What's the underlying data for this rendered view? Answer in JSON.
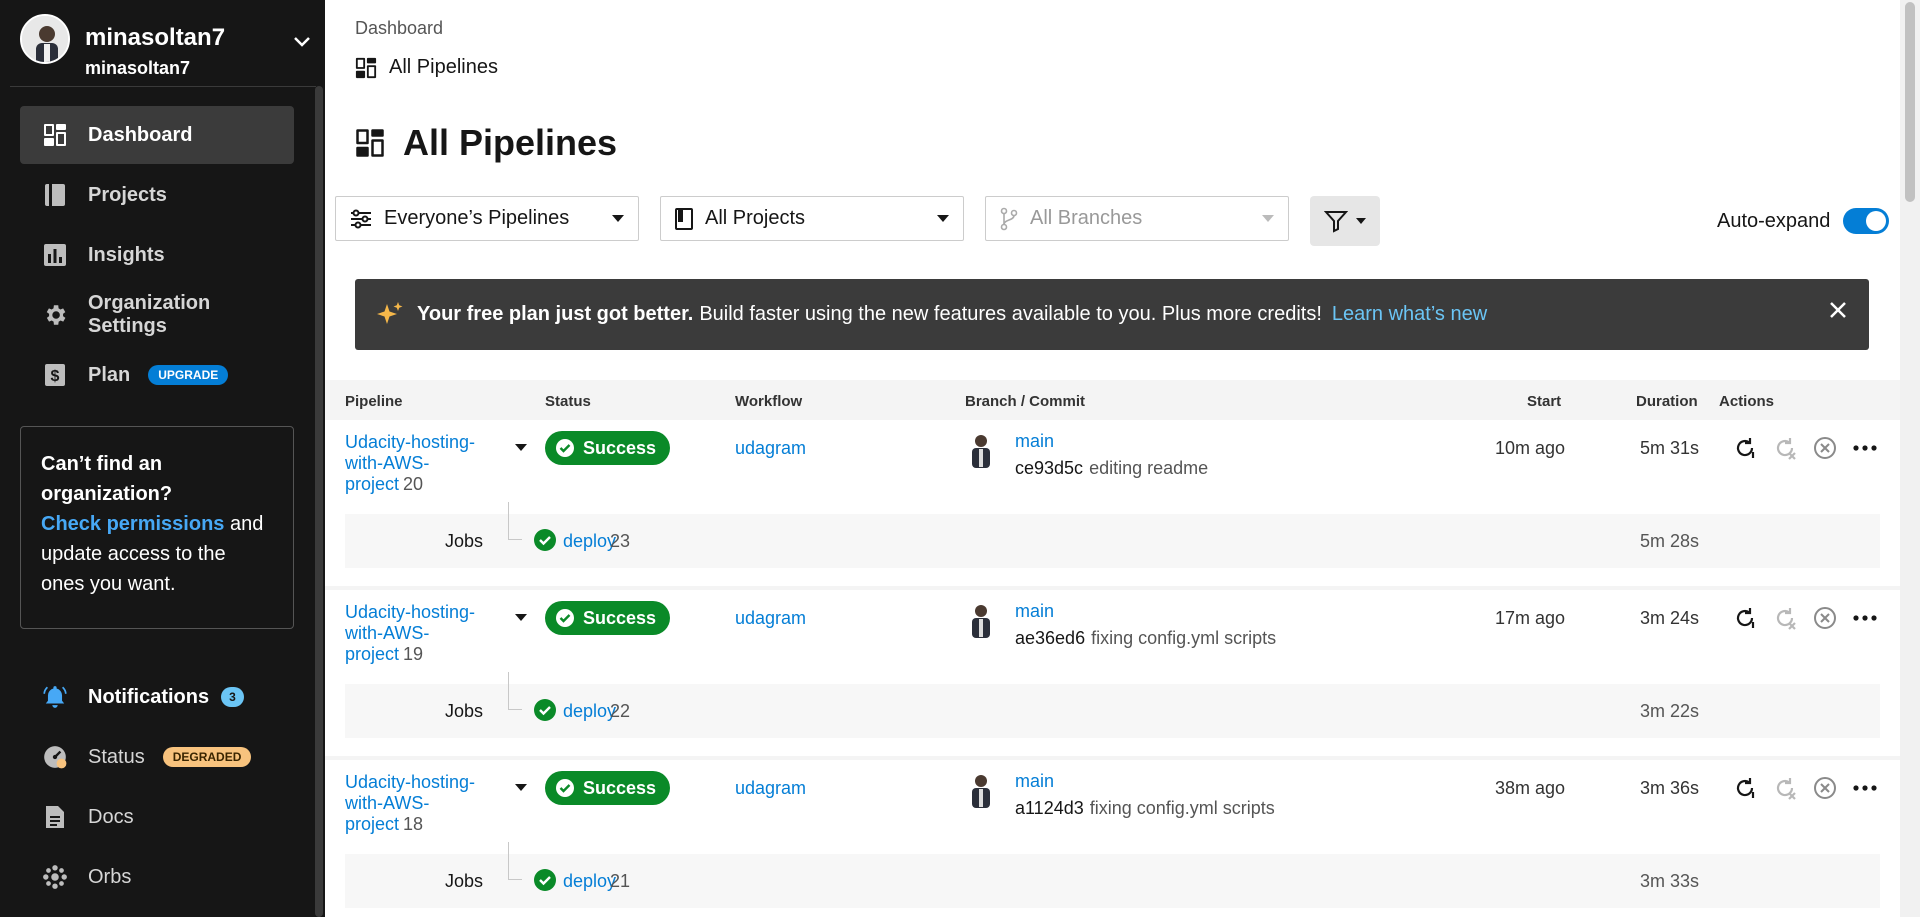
{
  "org": {
    "name": "minasoltan7",
    "sub": "minasoltan7"
  },
  "nav": {
    "dashboard": "Dashboard",
    "projects": "Projects",
    "insights": "Insights",
    "org_settings": "Organization Settings",
    "plan": "Plan",
    "plan_badge": "UPGRADE",
    "notifications": "Notifications",
    "notifications_count": "3",
    "status": "Status",
    "status_badge": "DEGRADED",
    "docs": "Docs",
    "orbs": "Orbs"
  },
  "callout": {
    "heading": "Can’t find an organization?",
    "link": "Check permissions",
    "rest": " and update access to the ones you want."
  },
  "breadcrumb": {
    "root": "Dashboard",
    "current": "All Pipelines"
  },
  "page_title": "All Pipelines",
  "filters": {
    "pipelines": "Everyone’s Pipelines",
    "projects": "All Projects",
    "branches": "All Branches"
  },
  "auto_expand_label": "Auto-expand",
  "banner": {
    "bold": "Your free plan just got better.",
    "text": "Build faster using the new features available to you. Plus more credits!",
    "link": "Learn what’s new"
  },
  "table": {
    "headers": {
      "pipeline": "Pipeline",
      "status": "Status",
      "workflow": "Workflow",
      "branch": "Branch / Commit",
      "start": "Start",
      "duration": "Duration",
      "actions": "Actions"
    },
    "jobs_label": "Jobs",
    "rows": [
      {
        "name": "Udacity-hosting-with-AWS-project",
        "num": "20",
        "status": "Success",
        "workflow": "udagram",
        "branch": "main",
        "sha": "ce93d5c",
        "msg": "editing readme",
        "start": "10m ago",
        "duration": "5m 31s",
        "job": "deploy",
        "job_num": "23",
        "job_duration": "5m 28s"
      },
      {
        "name": "Udacity-hosting-with-AWS-project",
        "num": "19",
        "status": "Success",
        "workflow": "udagram",
        "branch": "main",
        "sha": "ae36ed6",
        "msg": "fixing config.yml scripts",
        "start": "17m ago",
        "duration": "3m 24s",
        "job": "deploy",
        "job_num": "22",
        "job_duration": "3m 22s"
      },
      {
        "name": "Udacity-hosting-with-AWS-project",
        "num": "18",
        "status": "Success",
        "workflow": "udagram",
        "branch": "main",
        "sha": "a1124d3",
        "msg": "fixing config.yml scripts",
        "start": "38m ago",
        "duration": "3m 36s",
        "job": "deploy",
        "job_num": "21",
        "job_duration": "3m 33s"
      }
    ]
  },
  "colors": {
    "accent": "#047ed6",
    "success": "#0a8a28",
    "sidebar": "#161616",
    "banner": "#3b3b3b"
  }
}
